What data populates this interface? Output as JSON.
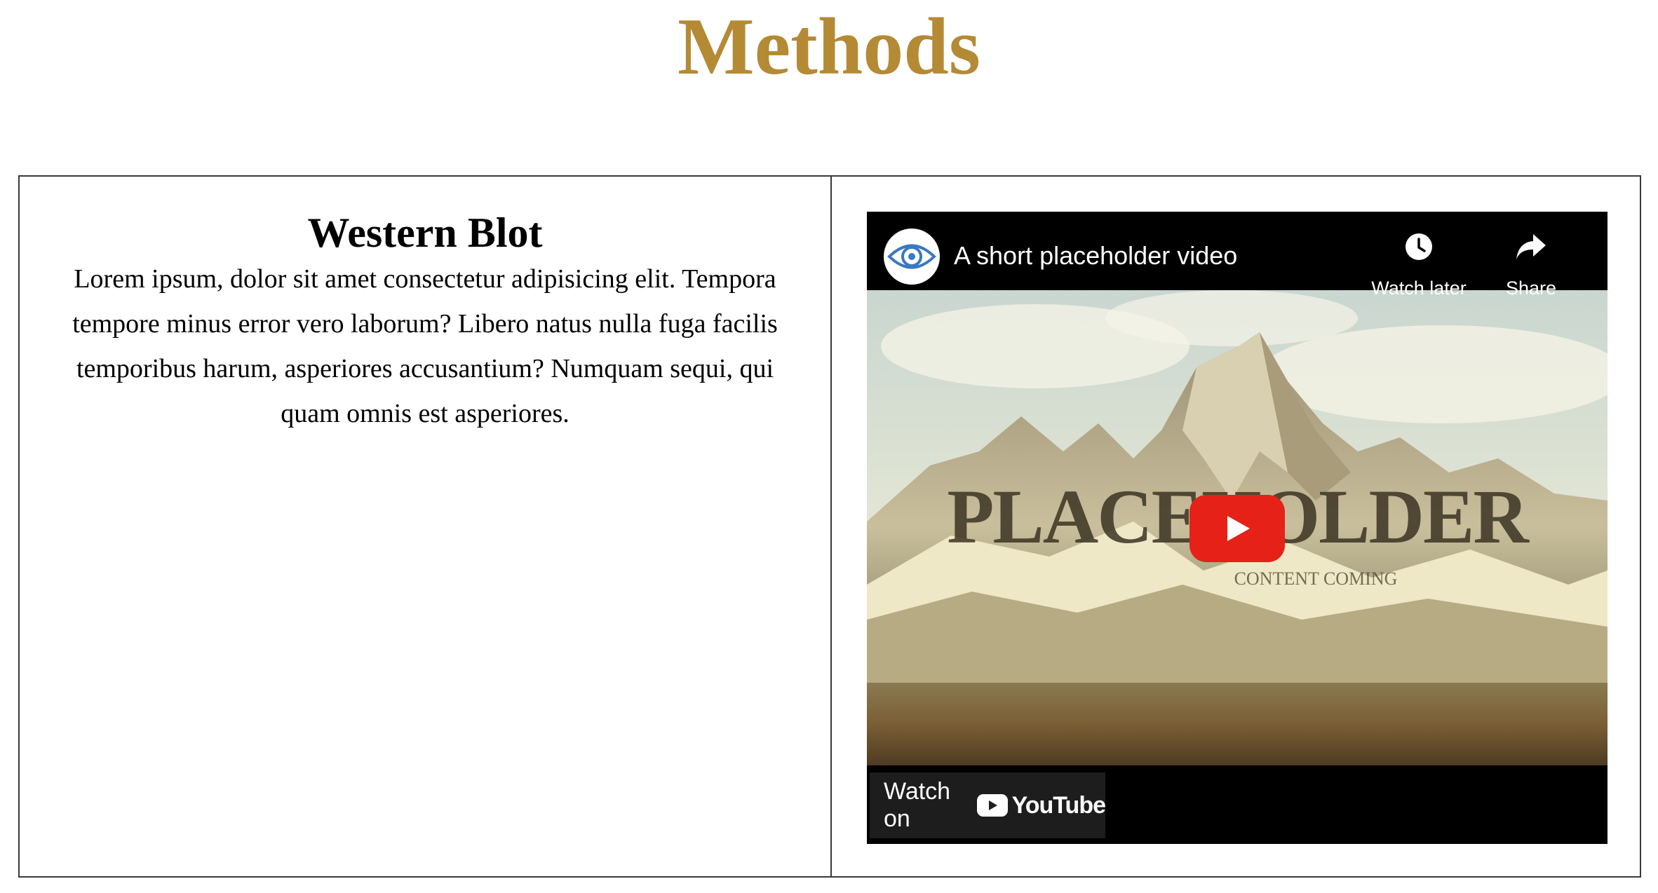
{
  "page": {
    "title": "Methods",
    "title_color": "#b48a35"
  },
  "section": {
    "heading": "Western Blot",
    "body": "Lorem ipsum, dolor sit amet consectetur adipisicing elit. Tempora tempore minus error vero laborum? Libero natus nulla fuga facilis temporibus harum, asperiores accusantium? Numquam sequi, qui quam omnis est asperiores."
  },
  "video": {
    "title": "A short placeholder video",
    "watch_later_label": "Watch later",
    "share_label": "Share",
    "watch_on_label": "Watch on",
    "youtube_word": "YouTube",
    "thumbnail_title": "PLACEHOLDER",
    "thumbnail_subtitle": "CONTENT COMING",
    "play_color": "#e62117",
    "channel_icon": "eye-icon"
  }
}
